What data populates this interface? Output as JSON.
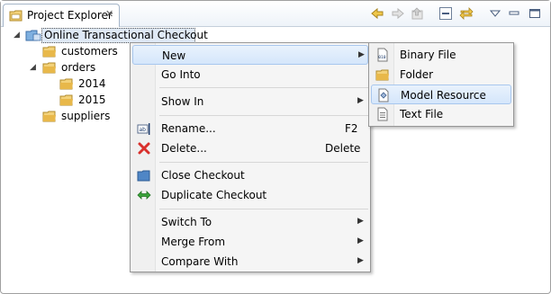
{
  "view": {
    "tab_title": "Project Explorer",
    "close_glyph": "✕",
    "toolbar_icons": [
      "back-arrow-icon",
      "forward-arrow-icon",
      "up-icon",
      "collapse-all-icon",
      "link-editor-icon",
      "view-menu-icon",
      "minimize-icon",
      "maximize-icon"
    ]
  },
  "tree": {
    "root": "Online Transactional Checkout",
    "items": [
      {
        "label": "customers"
      },
      {
        "label": "orders"
      },
      {
        "label": "2014"
      },
      {
        "label": "2015"
      },
      {
        "label": "suppliers"
      }
    ]
  },
  "context_menu": {
    "new": "New",
    "go_into": "Go Into",
    "show_in": "Show In",
    "rename": "Rename...",
    "rename_accel": "F2",
    "delete": "Delete...",
    "delete_accel": "Delete",
    "close_checkout": "Close Checkout",
    "duplicate_checkout": "Duplicate Checkout",
    "switch_to": "Switch To",
    "merge_from": "Merge From",
    "compare_with": "Compare With"
  },
  "submenu": {
    "binary_file": "Binary File",
    "folder": "Folder",
    "model_resource": "Model Resource",
    "text_file": "Text File",
    "binary_icon_text": "010"
  },
  "colors": {
    "folder": "#e8b84a",
    "highlight": "#d5e6fb",
    "delete_red": "#d9302c",
    "duplicate_green": "#3aa33a",
    "toolbar_yellow": "#e9c23d"
  }
}
